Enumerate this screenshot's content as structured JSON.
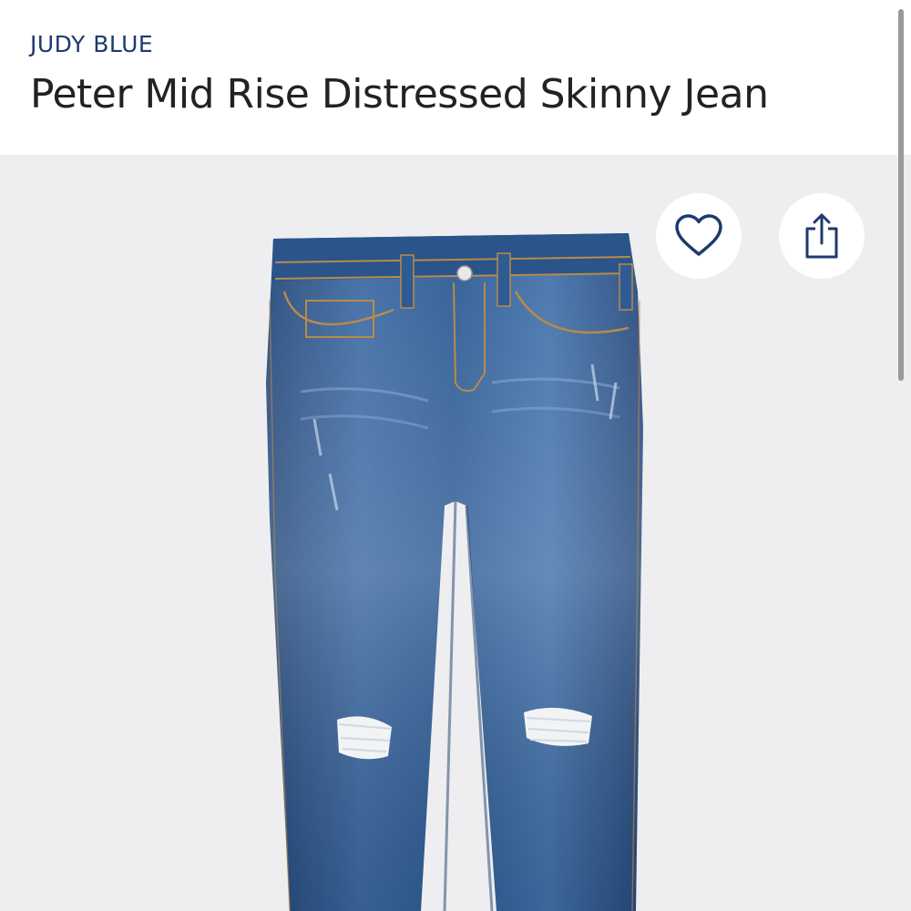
{
  "product": {
    "brand": "JUDY BLUE",
    "title": "Peter Mid Rise Distressed Skinny Jean"
  },
  "actions": {
    "favorite_icon": "heart-icon",
    "share_icon": "share-icon"
  },
  "colors": {
    "brand": "#1e3a6e",
    "title": "#222222",
    "gallery_bg": "#eeeef0",
    "denim": "#2f5c95"
  }
}
